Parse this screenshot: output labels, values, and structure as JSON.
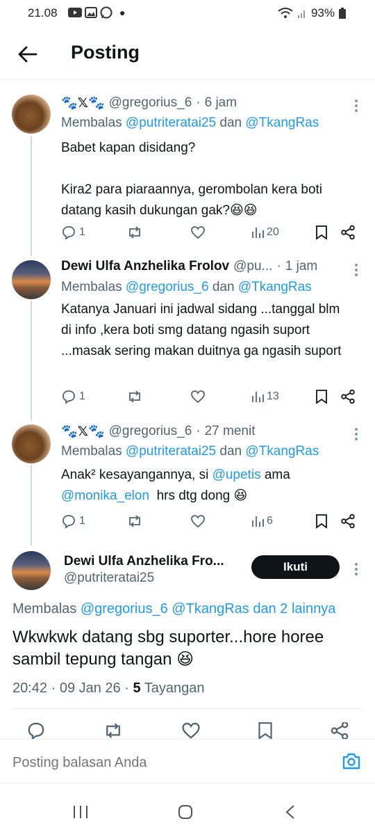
{
  "status_bar": {
    "time": "21.08",
    "battery": "93%"
  },
  "header": {
    "title": "Posting"
  },
  "tweets": [
    {
      "name_prefix": "🐾𝕏🐾",
      "handle": "@gregorius_6",
      "time": "6 jam",
      "reply_prefix": "Membalas ",
      "reply_mention1": "@putriteratai25",
      "reply_and": " dan ",
      "reply_mention2": "@TkangRas",
      "text_line1": "Babet kapan disidang?",
      "text_line2": "Kira2 para piaraannya, gerombolan kera boti datang kasih dukungan gak?😆😆",
      "replies": "1",
      "views": "20"
    },
    {
      "name": "Dewi Ulfa Anzhelika Frolov",
      "handle": "@pu...",
      "time": "1 jam",
      "reply_prefix": "Membalas ",
      "reply_mention1": "@gregorius_6",
      "reply_and": " dan ",
      "reply_mention2": "@TkangRas",
      "text": "Katanya Januari ini jadwal sidang ...tanggal blm di info ,kera boti smg datang ngasih suport ...masak sering makan duitnya ga ngasih suport",
      "replies": "1",
      "views": "13"
    },
    {
      "name_prefix": "🐾𝕏🐾",
      "handle": "@gregorius_6",
      "time": "27 menit",
      "reply_prefix": "Membalas ",
      "reply_mention1": "@putriteratai25",
      "reply_and": " dan ",
      "reply_mention2": "@TkangRas",
      "text_a": "Anak² kesayangannya, si ",
      "mention_a": "@upetis",
      "text_b": " ama",
      "mention_b": "@monika_elon",
      "text_c": "  hrs dtg dong 😆",
      "replies": "1",
      "views": "6"
    }
  ],
  "main_tweet": {
    "name": "Dewi Ulfa Anzhelika Fro...",
    "handle": "@putriteratai25",
    "follow_label": "Ikuti",
    "reply_prefix": "Membalas ",
    "reply_mention1": "@gregorius_6",
    "reply_mention2": "@TkangRas",
    "reply_suffix": " dan 2 lainnya",
    "text": "Wkwkwk datang sbg suporter...hore horee sambil tepung tangan 😆",
    "datetime": "20:42 · 09 Jan 26 · ",
    "views_count": "5",
    "views_label": " Tayangan"
  },
  "reply_bar": {
    "placeholder": "Posting balasan Anda"
  },
  "colors": {
    "accent": "#1d9bf0",
    "text": "#0f1419",
    "secondary": "#536471",
    "thread_line": "#cfd9de"
  }
}
